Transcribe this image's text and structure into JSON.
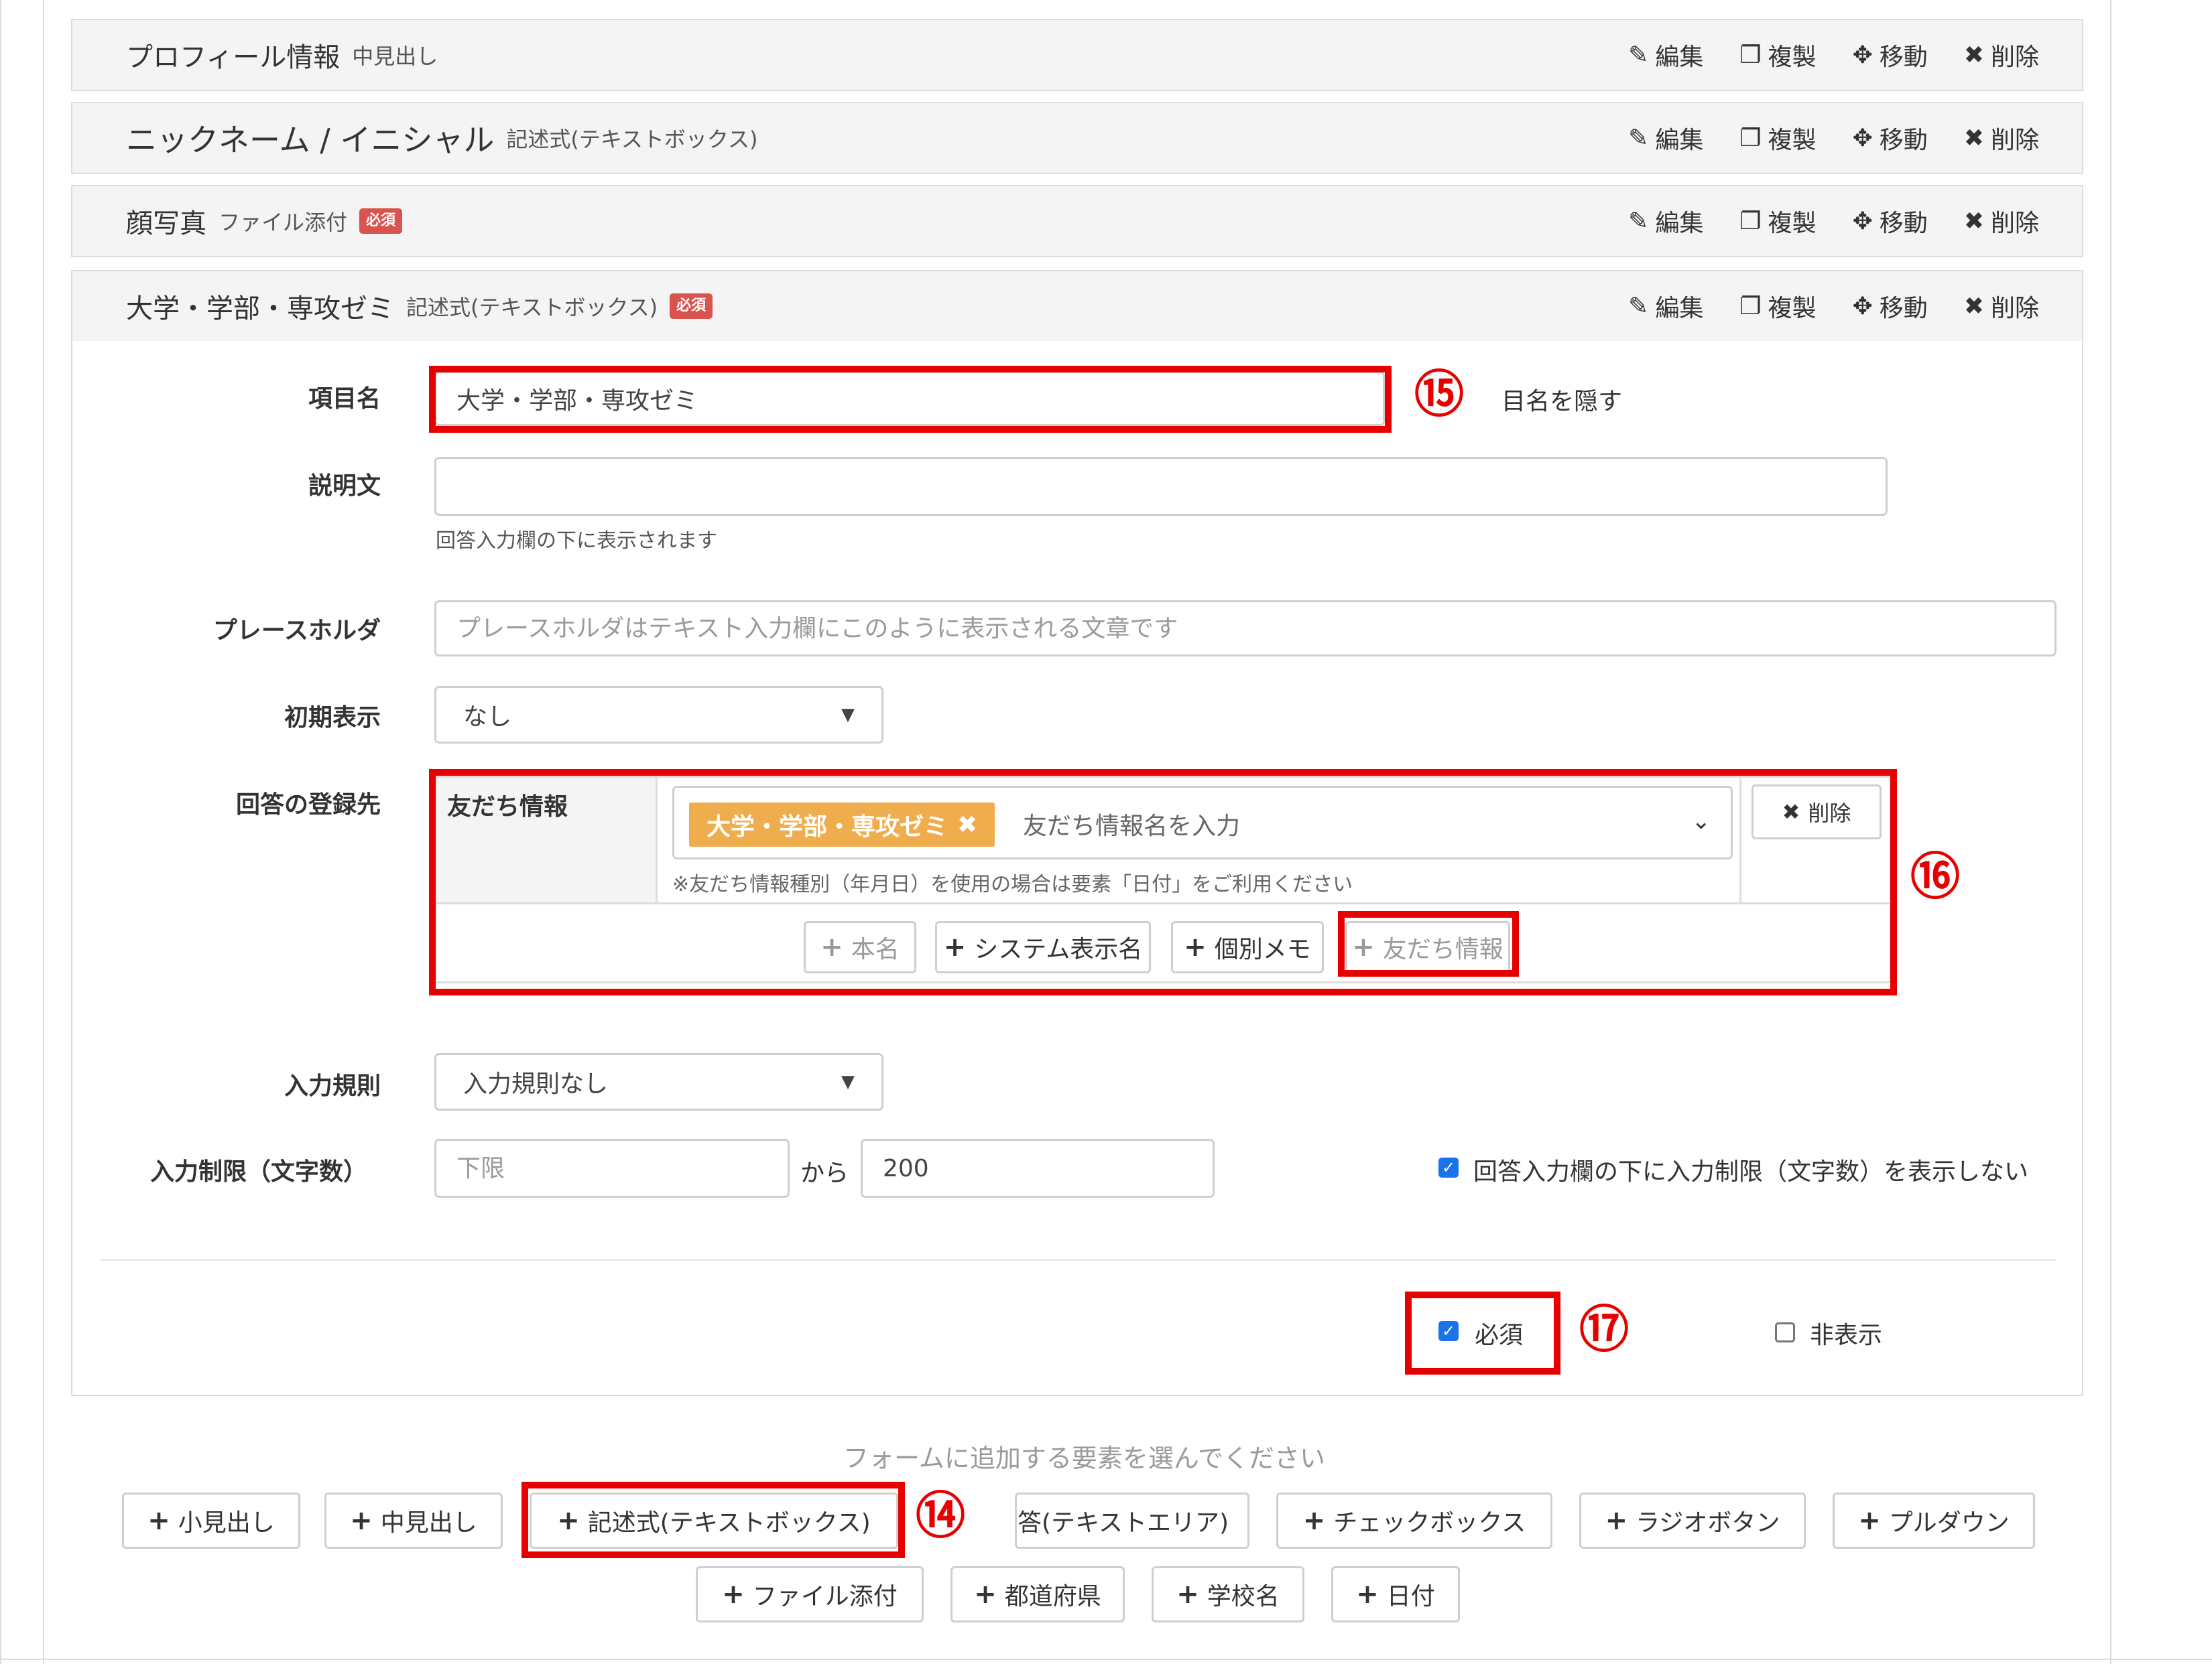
{
  "actions": {
    "edit": "編集",
    "duplicate": "複製",
    "move": "移動",
    "delete": "削除"
  },
  "items": [
    {
      "title": "プロフィール情報",
      "type": "中見出し",
      "required": false
    },
    {
      "title": "ニックネーム / イニシャル",
      "type": "記述式(テキストボックス)",
      "required": false
    },
    {
      "title": "顔写真",
      "type": "ファイル添付",
      "required": true
    },
    {
      "title": "大学・学部・専攻ゼミ",
      "type": "記述式(テキストボックス)",
      "required": true
    }
  ],
  "required_badge": "必須",
  "editor": {
    "item_name": {
      "label": "項目名",
      "value": "大学・学部・専攻ゼミ",
      "hide_name": "目名を隠す"
    },
    "description": {
      "label": "説明文",
      "value": "",
      "help": "回答入力欄の下に表示されます"
    },
    "placeholder_field": {
      "label": "プレースホルダ",
      "placeholder": "プレースホルダはテキスト入力欄にこのように表示される文章です"
    },
    "initial_display": {
      "label": "初期表示",
      "selected": "なし"
    },
    "registration": {
      "label": "回答の登録先",
      "header": "友だち情報",
      "tag": "大学・学部・専攻ゼミ",
      "tag_placeholder": "友だち情報名を入力",
      "note": "※友だち情報種別（年月日）を使用の場合は要素「日付」をご利用ください",
      "delete": "削除",
      "buttons": [
        "本名",
        "システム表示名",
        "個別メモ",
        "友だち情報"
      ]
    },
    "input_rule": {
      "label": "入力規則",
      "selected": "入力規則なし"
    },
    "input_limit": {
      "label": "入力制限（文字数）",
      "min_placeholder": "下限",
      "from": "から",
      "max": "200",
      "hide_limit_label": "回答入力欄の下に入力制限（文字数）を表示しない",
      "hide_limit_checked": true
    },
    "required": {
      "label": "必須",
      "checked": true
    },
    "hidden": {
      "label": "非表示",
      "checked": false
    }
  },
  "add_section": {
    "prompt": "フォームに追加する要素を選んでください",
    "row1": [
      "小見出し",
      "中見出し",
      "記述式(テキストボックス)",
      "答(テキストエリア)",
      "チェックボックス",
      "ラジオボタン",
      "プルダウン"
    ],
    "row2": [
      "ファイル添付",
      "都道府県",
      "学校名",
      "日付"
    ]
  },
  "annotations": [
    "⑭",
    "⑮",
    "⑯",
    "⑰"
  ],
  "colors": {
    "annotation": "#e60000",
    "tag": "#f0ad4e",
    "required_badge": "#d9534f",
    "checkbox": "#1a73e8"
  }
}
